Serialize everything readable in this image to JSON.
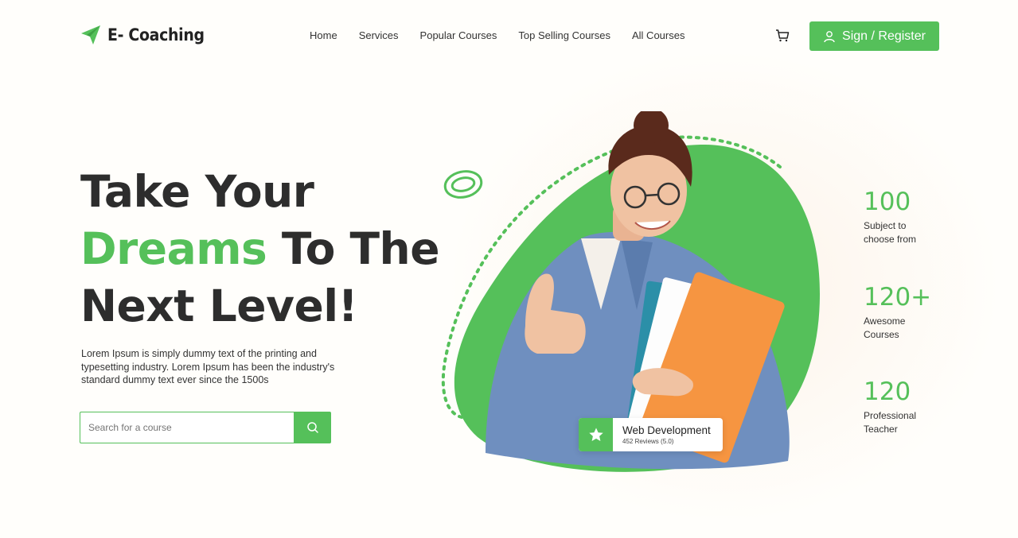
{
  "brand": {
    "name": "E- Coaching",
    "accent": "#55c05a"
  },
  "nav": {
    "items": [
      "Home",
      "Services",
      "Popular Courses",
      "Top Selling Courses",
      "All Courses"
    ],
    "cart_icon": "cart-icon",
    "signin_label": "Sign / Register"
  },
  "hero": {
    "line1": "Take Your",
    "line2_green": "Dreams",
    "line2_rest": " To The",
    "line3": "Next Level!",
    "lead": "Lorem Ipsum is simply dummy text of the printing and typesetting industry. Lorem Ipsum has been the industry's standard dummy text ever since the 1500s",
    "search_placeholder": "Search for a course"
  },
  "course_card": {
    "title": "Web Development",
    "subtitle": "452 Reviews (5.0)"
  },
  "stats": [
    {
      "number": "100",
      "label": "Subject to choose from"
    },
    {
      "number": "120+",
      "label": "Awesome Courses"
    },
    {
      "number": "120",
      "label": "Professional Teacher"
    }
  ]
}
